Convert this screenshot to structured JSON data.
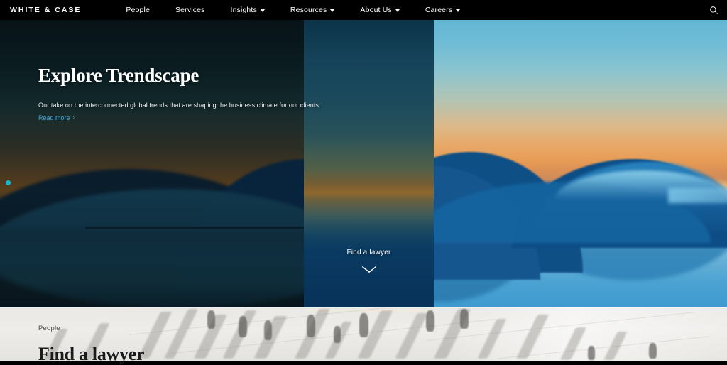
{
  "nav": {
    "logo": "WHITE & CASE",
    "items": [
      {
        "label": "People",
        "has_caret": false
      },
      {
        "label": "Services",
        "has_caret": false
      },
      {
        "label": "Insights",
        "has_caret": true
      },
      {
        "label": "Resources",
        "has_caret": true
      },
      {
        "label": "About Us",
        "has_caret": true
      },
      {
        "label": "Careers",
        "has_caret": true
      }
    ],
    "search_icon": "search-icon"
  },
  "hero": {
    "title": "Explore Trendscape",
    "subtitle": "Our take on the interconnected global trends that are shaping the business climate for our clients.",
    "read_more": "Read more",
    "read_more_chevron": "›",
    "carousel_dot_color": "#17b6c8",
    "link_color": "#3fa9d8",
    "find_a_lawyer": "Find a lawyer",
    "scroll_chevron_icon": "chevron-down-icon"
  },
  "bottom": {
    "eyebrow": "People",
    "title": "Find a lawyer"
  }
}
